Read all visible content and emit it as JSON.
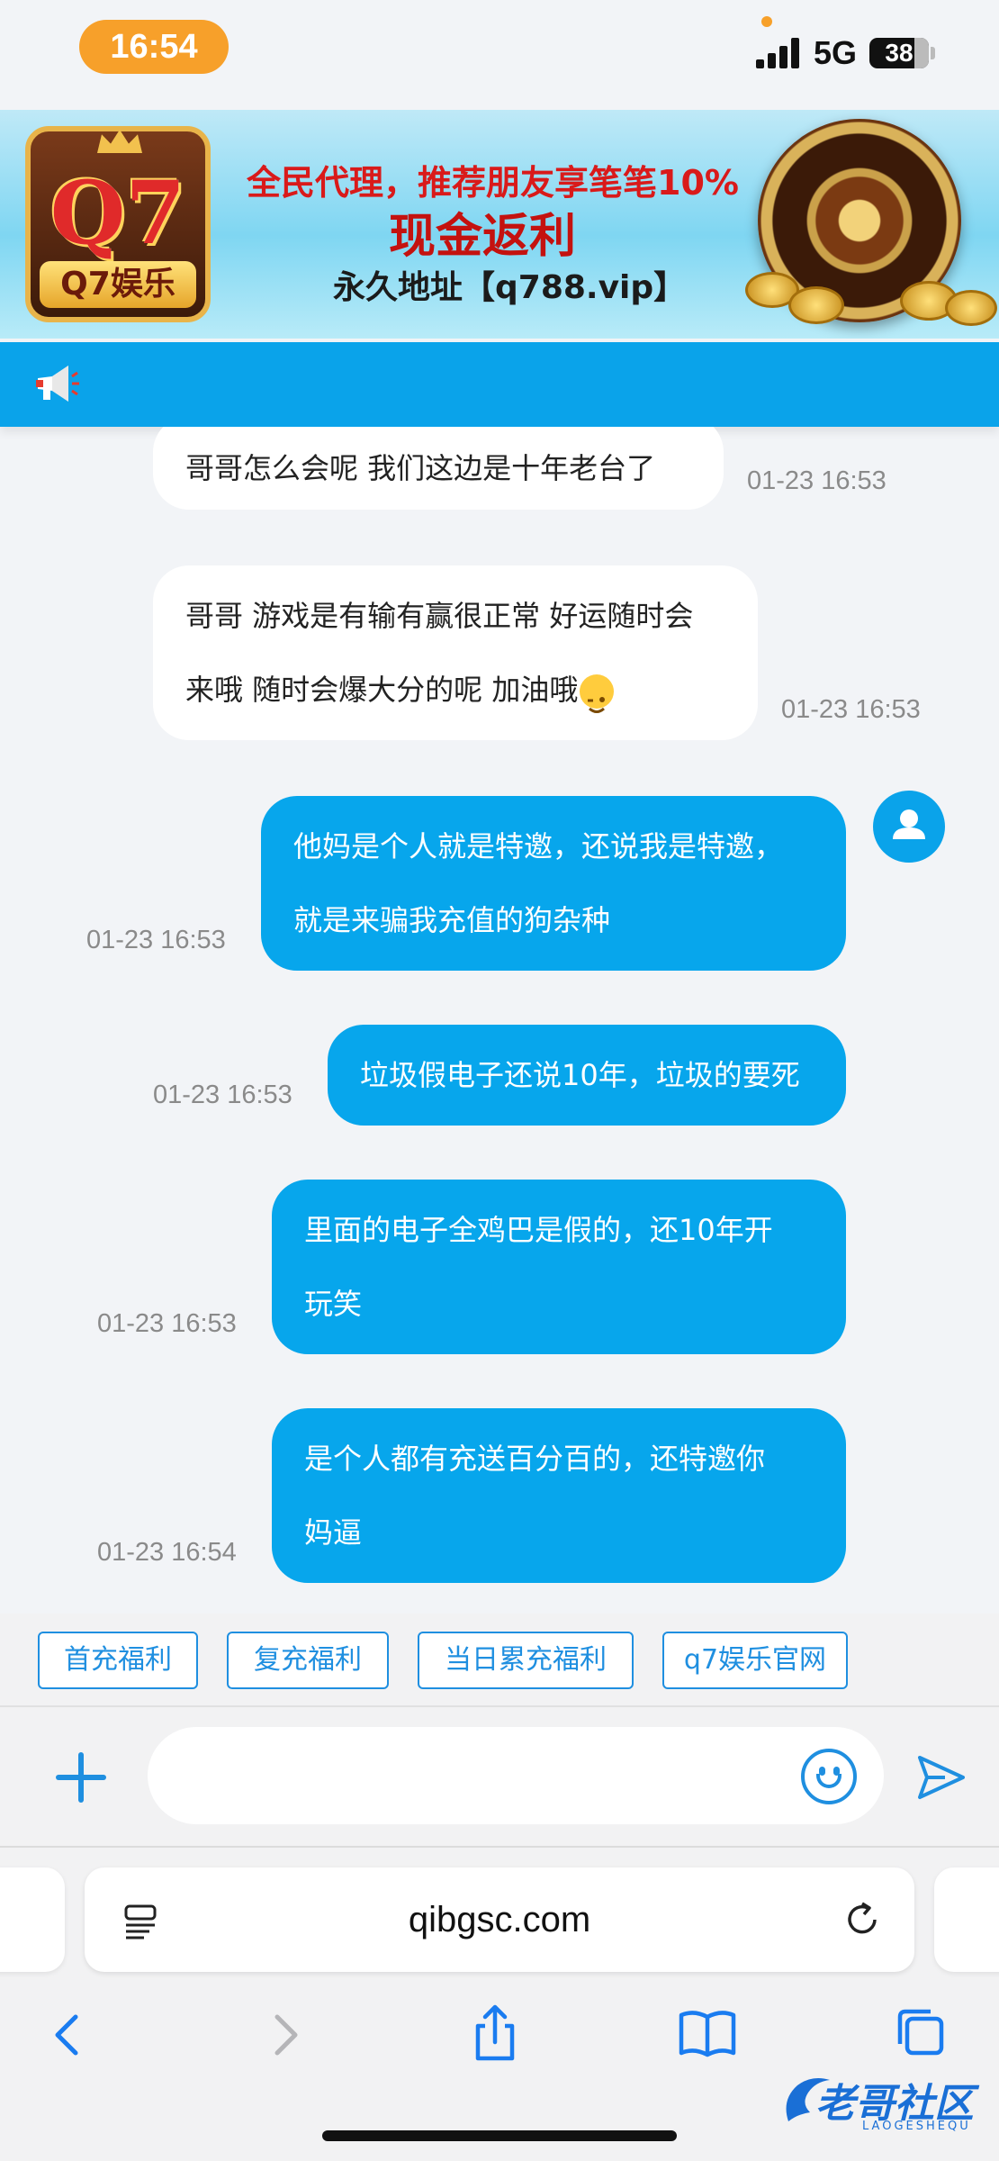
{
  "status_bar": {
    "time": "16:54",
    "network": "5G",
    "battery": "38"
  },
  "banner": {
    "logo_text": "Q7",
    "logo_brand": "Q7娱乐",
    "line1": "全民代理，推荐朋友享笔笔10%",
    "line2": "现金返利",
    "line3": "永久地址【q788.vip】"
  },
  "messages": [
    {
      "side": "in",
      "text": "哥哥怎么会呢 我们这边是十年老台了",
      "time": "01-23 16:53"
    },
    {
      "side": "in",
      "line1": "哥哥 游戏是有输有赢很正常 好运随时会",
      "line2": "来哦 随时会爆大分的呢 加油哦",
      "time": "01-23 16:53"
    },
    {
      "side": "out",
      "line1": "他妈是个人就是特邀，还说我是特邀，",
      "line2": "就是来骗我充值的狗杂种",
      "time": "01-23 16:53"
    },
    {
      "side": "out",
      "text": "垃圾假电子还说10年，垃圾的要死",
      "time": "01-23 16:53"
    },
    {
      "side": "out",
      "line1": "里面的电子全鸡巴是假的，还10年开",
      "line2": "玩笑",
      "time": "01-23 16:53"
    },
    {
      "side": "out",
      "line1": "是个人都有充送百分百的，还特邀你",
      "line2": "妈逼",
      "time": "01-23 16:54"
    }
  ],
  "quick_replies": [
    "首充福利",
    "复充福利",
    "当日累充福利",
    "q7娱乐官网"
  ],
  "input": {
    "value": "",
    "placeholder": ""
  },
  "browser": {
    "url": "qibgsc.com"
  },
  "watermark": {
    "text": "老哥社区",
    "sub": "LAOGESHEQU"
  },
  "colors": {
    "accent": "#07a6ec",
    "time_pill": "#f7a02a",
    "chip": "#1f8fe0"
  },
  "icons": [
    "megaphone-icon",
    "avatar-icon",
    "plus-icon",
    "smiley-icon",
    "send-icon",
    "reader-icon",
    "reload-icon",
    "back-icon",
    "forward-icon",
    "share-icon",
    "bookmarks-icon",
    "tabs-icon"
  ]
}
